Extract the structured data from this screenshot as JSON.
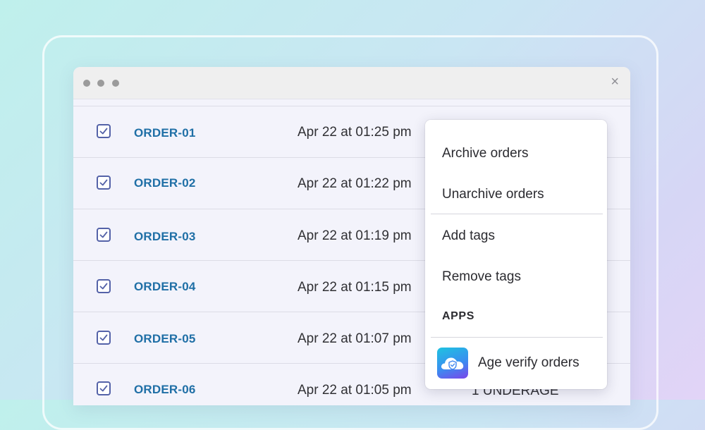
{
  "window": {
    "close_glyph": "×"
  },
  "orders": [
    {
      "id": "ORDER-01",
      "date": "Apr 22 at 01:25 pm"
    },
    {
      "id": "ORDER-02",
      "date": "Apr 22 at 01:22 pm"
    },
    {
      "id": "ORDER-03",
      "date": "Apr 22 at 01:19 pm"
    },
    {
      "id": "ORDER-04",
      "date": "Apr 22 at 01:15 pm"
    },
    {
      "id": "ORDER-05",
      "date": "Apr 22 at 01:07 pm"
    },
    {
      "id": "ORDER-06",
      "date": "Apr 22 at 01:05 pm",
      "status": "1 UNDERAGE"
    }
  ],
  "menu": {
    "archive": "Archive orders",
    "unarchive": "Unarchive orders",
    "add_tags": "Add tags",
    "remove_tags": "Remove tags",
    "apps_heading": "APPS",
    "app_age_verify": "Age verify orders"
  },
  "colors": {
    "link": "#1f6fa6",
    "checkbox": "#5462a8",
    "app_icon_gradient": [
      "#1ec3e0",
      "#3a8ef0",
      "#7b45ea"
    ]
  },
  "icons": {
    "checkbox": "checkmark-icon",
    "app": "cloud-shield-icon"
  }
}
